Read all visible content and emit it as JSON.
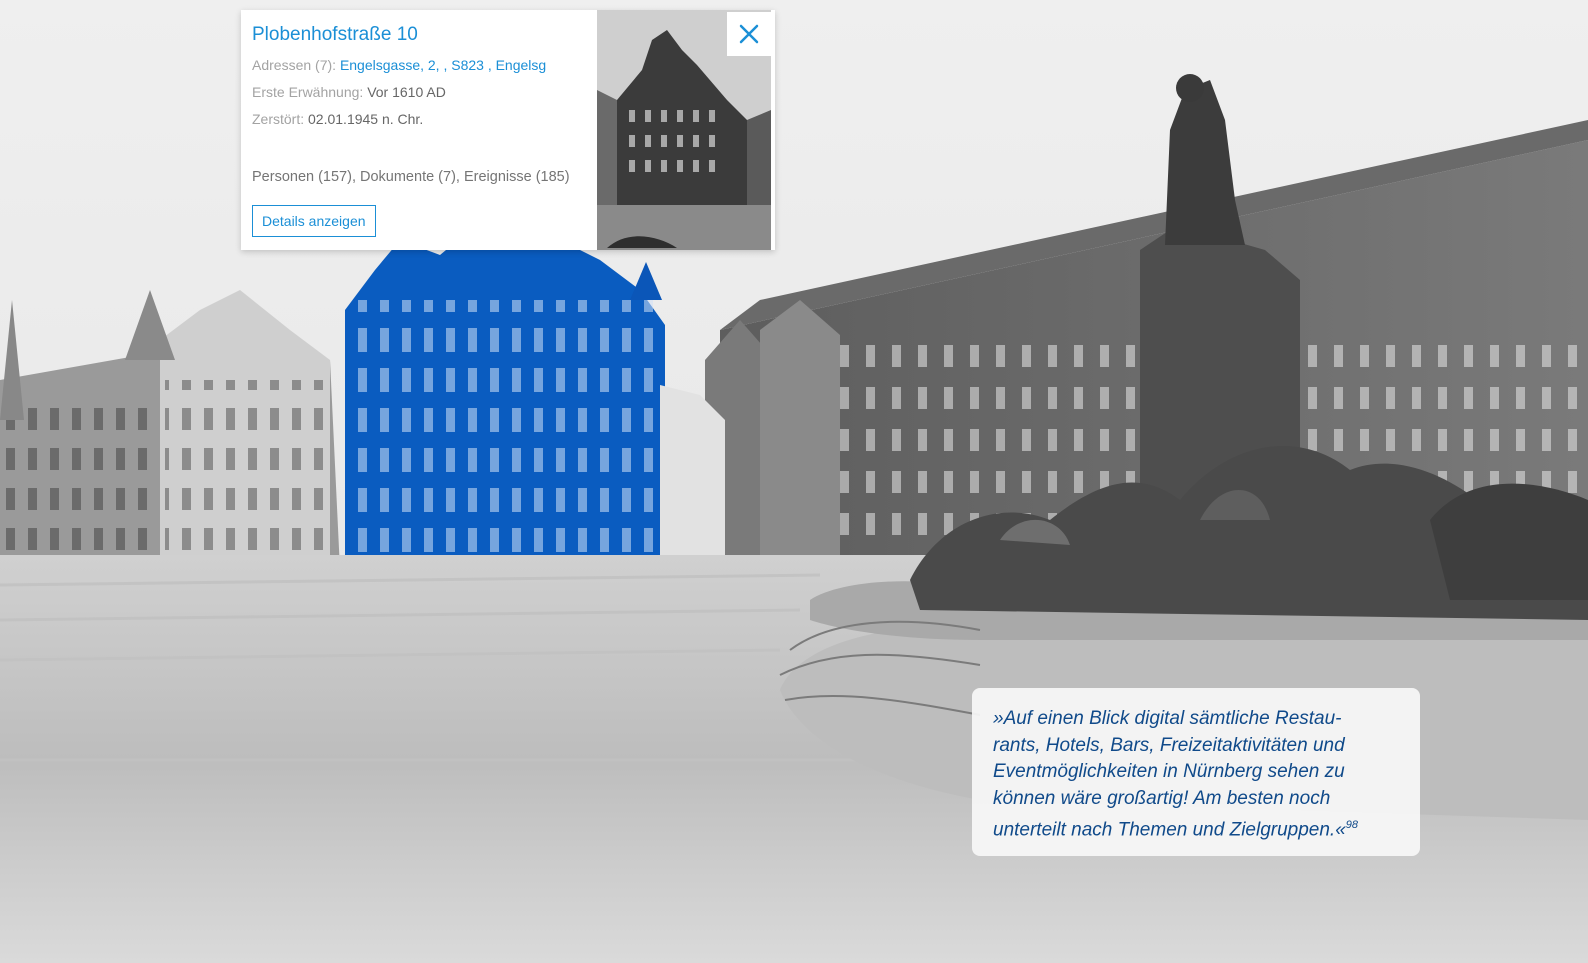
{
  "popup": {
    "title": "Plobenhofstraße 10",
    "addresses_label": "Adressen (7):",
    "addresses_value": "Engelsgasse, 2, , S823 , Engelsg",
    "first_mention_label": "Erste Erwähnung:",
    "first_mention_value": "Vor 1610 AD",
    "destroyed_label": "Zerstört:",
    "destroyed_value": "02.01.1945 n. Chr.",
    "counts": "Personen (157), Dokumente (7), Ereignisse (185)",
    "details_button": "Details anzeigen",
    "close_icon": "close-icon"
  },
  "quote": {
    "lines": [
      "»Auf einen Blick digital sämtliche Restau-",
      "rants, Hotels, Bars, Freizeitaktivitäten und",
      "Eventmöglichkeiten in Nürnberg sehen zu",
      "können wäre großartig! Am besten noch",
      "unterteilt nach Themen und Zielgruppen.«"
    ],
    "footnote": "98"
  },
  "colors": {
    "accent": "#1b8fd6",
    "highlight_building": "#0a5cc0",
    "quote_text": "#104a8a"
  }
}
